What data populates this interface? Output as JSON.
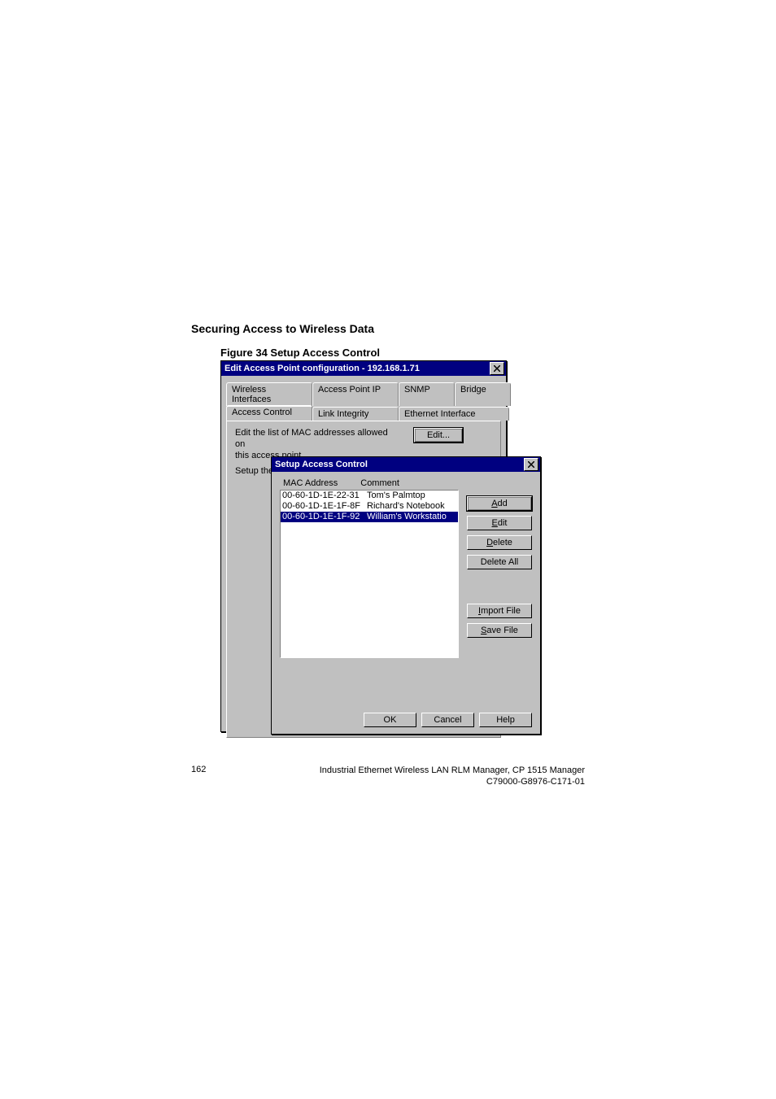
{
  "page": {
    "section_title": "Securing Access to Wireless Data",
    "figure_caption": "Figure 34    Setup Access Control",
    "page_number": "162",
    "footer_line1": "Industrial Ethernet Wireless LAN  RLM Manager,  CP 1515 Manager",
    "footer_line2": "C79000-G8976-C171-01"
  },
  "window1": {
    "title": "Edit Access Point configuration - 192.168.1.71",
    "tabs_row1": [
      "Wireless Interfaces",
      "Access Point IP",
      "SNMP",
      "Bridge"
    ],
    "tabs_row2": [
      "Access Control",
      "Link Integrity",
      "Ethernet Interface"
    ],
    "active_tab": "Access Control",
    "desc_line1": "Edit the list of MAC addresses allowed on",
    "desc_line2": "this access point.",
    "edit_button": "Edit...",
    "setup_prefix": "Setup the RA"
  },
  "window2": {
    "title": "Setup Access Control",
    "col_mac": "MAC Address",
    "col_comment": "Comment",
    "rows": [
      {
        "mac": "00-60-1D-1E-22-31",
        "comment": "Tom's Palmtop",
        "selected": false
      },
      {
        "mac": "00-60-1D-1E-1F-8F",
        "comment": "Richard's Notebook",
        "selected": false
      },
      {
        "mac": "00-60-1D-1E-1F-92",
        "comment": "William's Workstatio",
        "selected": true
      }
    ],
    "buttons": {
      "add": "Add",
      "edit": "Edit",
      "delete": "Delete",
      "delete_all": "Delete All",
      "import": "Import File",
      "save": "Save File",
      "ok": "OK",
      "cancel": "Cancel",
      "help": "Help"
    }
  }
}
